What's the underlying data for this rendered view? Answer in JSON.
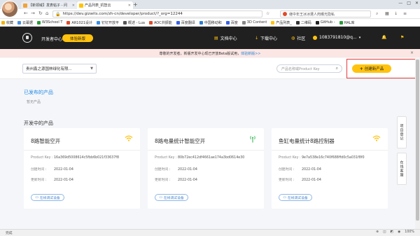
{
  "browser": {
    "tabs": [
      {
        "label": "【新领域】发表帖子 - 问",
        "active": false,
        "favicon_color": "#f2a33a"
      },
      {
        "label": "产品列表_机智云",
        "active": true,
        "favicon_color": "#ffc30f"
      }
    ],
    "new_tab": "+",
    "window_controls": [
      "—",
      "□",
      "✕"
    ],
    "url": "https://dev.gizwits.com/zh-cn/developer/product/?_org=12244",
    "search_placeholder": "继中年王冰冰遭人肉曝光隐私",
    "bookmarks": [
      {
        "label": "收藏",
        "color": "#f5b400"
      },
      {
        "label": "云幕据",
        "color": "#4a90e2"
      },
      {
        "label": "W3School T",
        "color": "#2b9c3a"
      },
      {
        "label": "AR1021设计",
        "color": "#e04a2b"
      },
      {
        "label": "钉钉开放平",
        "color": "#3a8ee6"
      },
      {
        "label": "概述 - Lua",
        "color": "#555555"
      },
      {
        "label": "AOC共振能",
        "color": "#e04a2b"
      },
      {
        "label": "百度翻译",
        "color": "#3a62e6"
      },
      {
        "label": "中国移动和",
        "color": "#2e7dd1"
      },
      {
        "label": "百度",
        "color": "#3a62e6"
      },
      {
        "label": "3D Content",
        "color": "#888888"
      },
      {
        "label": "产品列表_",
        "color": "#ffc30f"
      },
      {
        "label": "二维码",
        "color": "#333333"
      },
      {
        "label": "GitHub -",
        "color": "#222222"
      },
      {
        "label": "HAL库",
        "color": "#2b9c3a"
      }
    ]
  },
  "header": {
    "title": "开发者中心",
    "experience_label": "体验新版",
    "nav": [
      {
        "icon": "doc-icon",
        "glyph": "▤",
        "label": "文档中心"
      },
      {
        "icon": "download-icon",
        "glyph": "↓",
        "label": "下载中心"
      },
      {
        "icon": "community-icon",
        "glyph": "◍",
        "label": "社区"
      }
    ],
    "user": "1083791810@q...",
    "bell_glyph": "🔔",
    "extra_glyph": "⚑"
  },
  "notice": {
    "text": "尊敬的开发者，新版开发中心现已开放Beta版试用，",
    "link": "体验新版>>",
    "close": "×"
  },
  "toolbar": {
    "company": "贵州鑫之源国林绿化有限...",
    "search_placeholder": "产品名称或Product Key",
    "create_label": "创建新产品"
  },
  "sections": {
    "published_title": "已发布的产品",
    "no_product": "暂无产品",
    "development_title": "开发中的产品"
  },
  "labels": {
    "product_key": "Product Key :",
    "created": "创建时间 :",
    "updated": "更新时间 :",
    "debug_button": "在线调试设备"
  },
  "cards": [
    {
      "name": "8路智能空开",
      "product_key": "16a369d5008614c5fbb6b021f33637f8",
      "created": "2022-01-04",
      "updated": "2022-01-04",
      "icon": "wifi-icon",
      "icon_color": "#ffc30f"
    },
    {
      "name": "8路电量统计智能空开",
      "product_key": "80b72ec412df4661ae174a3bd0614e30",
      "created": "2022-01-04",
      "updated": "2022-01-04",
      "icon": "signal-icon",
      "icon_color": "#3db85c"
    },
    {
      "name": "鱼缸电量统计8路控制器",
      "product_key": "9e7a538e16c740f688ffd0c5a031f8f0",
      "created": "2022-01-04",
      "updated": "2022-01-04",
      "icon": "wifi-icon",
      "icon_color": "#ffc30f"
    }
  ],
  "side_tabs": [
    "项目登记",
    "在线客服"
  ],
  "statusbar": {
    "left": "完成",
    "right": [
      "⊕",
      "◫",
      "◩",
      "◉",
      "100%"
    ]
  }
}
